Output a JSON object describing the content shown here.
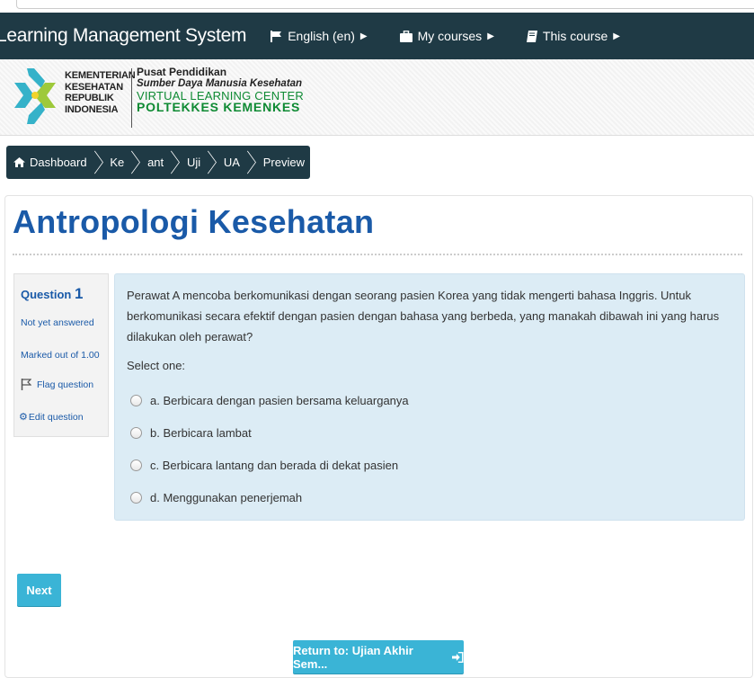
{
  "navbar": {
    "brand": "Learning Management System",
    "items": [
      {
        "label": "English (en)",
        "icon": "flag-icon"
      },
      {
        "label": "My courses",
        "icon": "briefcase-icon"
      },
      {
        "label": "This course",
        "icon": "book-icon"
      }
    ]
  },
  "banner": {
    "kementerian_lines": [
      "KEMENTERIAN",
      "KESEHATAN",
      "REPUBLIK",
      "INDONESIA"
    ],
    "pusat_lines": [
      "Pusat Pendidikan",
      "Sumber Daya Manusia Kesehatan",
      "VIRTUAL LEARNING CENTER",
      "POLTEKKES KEMENKES"
    ]
  },
  "breadcrumb": [
    "Dashboard",
    "Ke",
    "ant",
    "Uji",
    "UA",
    "Preview"
  ],
  "page": {
    "title": "Antropologi Kesehatan"
  },
  "question": {
    "label": "Question",
    "number": "1",
    "state": "Not yet answered",
    "grade": "Marked out of 1.00",
    "flag": "Flag question",
    "edit": "Edit question",
    "text": "Perawat A mencoba berkomunikasi dengan seorang pasien Korea yang tidak mengerti bahasa Inggris. Untuk berkomunikasi secara efektif dengan pasien dengan bahasa yang berbeda, yang manakah dibawah ini yang harus dilakukan oleh perawat?",
    "prompt": "Select one:",
    "options": [
      "a. Berbicara dengan pasien bersama keluarganya",
      "b. Berbicara lambat",
      "c. Berbicara lantang dan berada di dekat pasien",
      "d. Menggunakan penerjemah"
    ]
  },
  "buttons": {
    "next": "Next",
    "return": "Return to: Ujian Akhir Sem..."
  },
  "colors": {
    "navbar": "#1f3a45",
    "title": "#1a5aa8",
    "question_bg": "#dcecf5",
    "button": "#3ab4d6"
  }
}
